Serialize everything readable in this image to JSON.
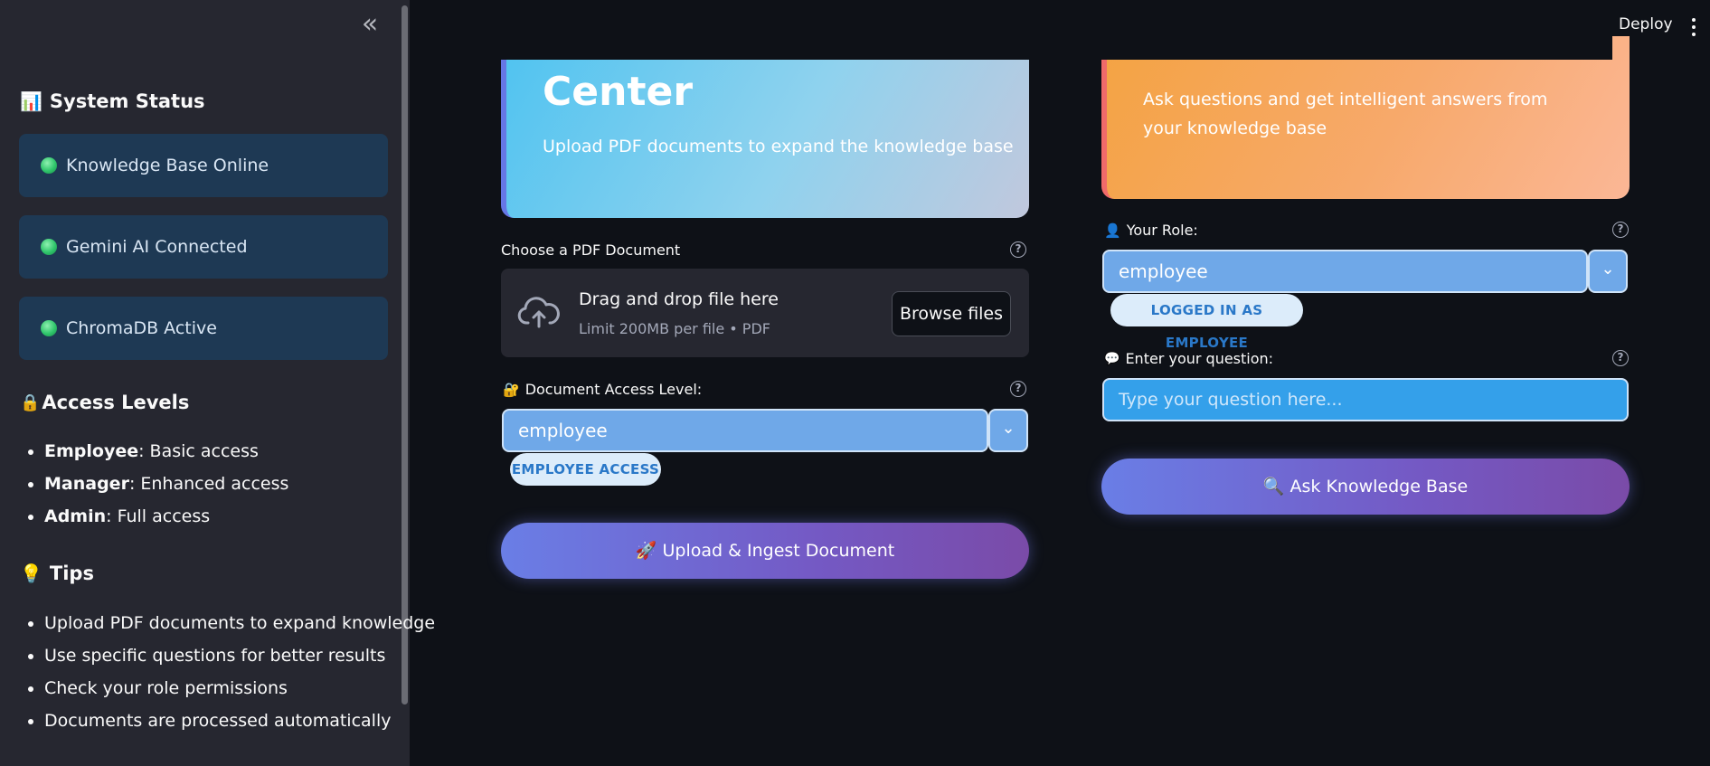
{
  "header": {
    "deploy_label": "Deploy"
  },
  "sidebar": {
    "system_status": {
      "heading": "System Status",
      "items": [
        {
          "label": "Knowledge Base Online"
        },
        {
          "label": "Gemini AI Connected"
        },
        {
          "label": "ChromaDB Active"
        }
      ]
    },
    "access_levels": {
      "heading": "Access Levels",
      "items": [
        {
          "role": "Employee",
          "desc": ": Basic access"
        },
        {
          "role": "Manager",
          "desc": ": Enhanced access"
        },
        {
          "role": "Admin",
          "desc": ": Full access"
        }
      ]
    },
    "tips": {
      "heading": "Tips",
      "items": [
        "Upload PDF documents to expand knowledge",
        "Use specific questions for better results",
        "Check your role permissions",
        "Documents are processed automatically"
      ]
    }
  },
  "upload": {
    "hero_title": "Center",
    "hero_subtitle": "Upload PDF documents to expand the knowledge base",
    "file_label": "Choose a PDF Document",
    "dropzone_title": "Drag and drop file here",
    "dropzone_limit": "Limit 200MB per file • PDF",
    "browse_label": "Browse files",
    "access_label": "Document Access Level:",
    "access_value": "employee",
    "access_pill": "EMPLOYEE ACCESS",
    "submit_label": "Upload & Ingest Document"
  },
  "query": {
    "hero_subtitle": "Ask questions and get intelligent answers from your knowledge base",
    "role_label": "Your Role:",
    "role_value": "employee",
    "role_pill": "LOGGED IN AS EMPLOYEE",
    "question_label": "Enter your question:",
    "question_placeholder": "Type your question here...",
    "submit_label": "Ask Knowledge Base"
  }
}
